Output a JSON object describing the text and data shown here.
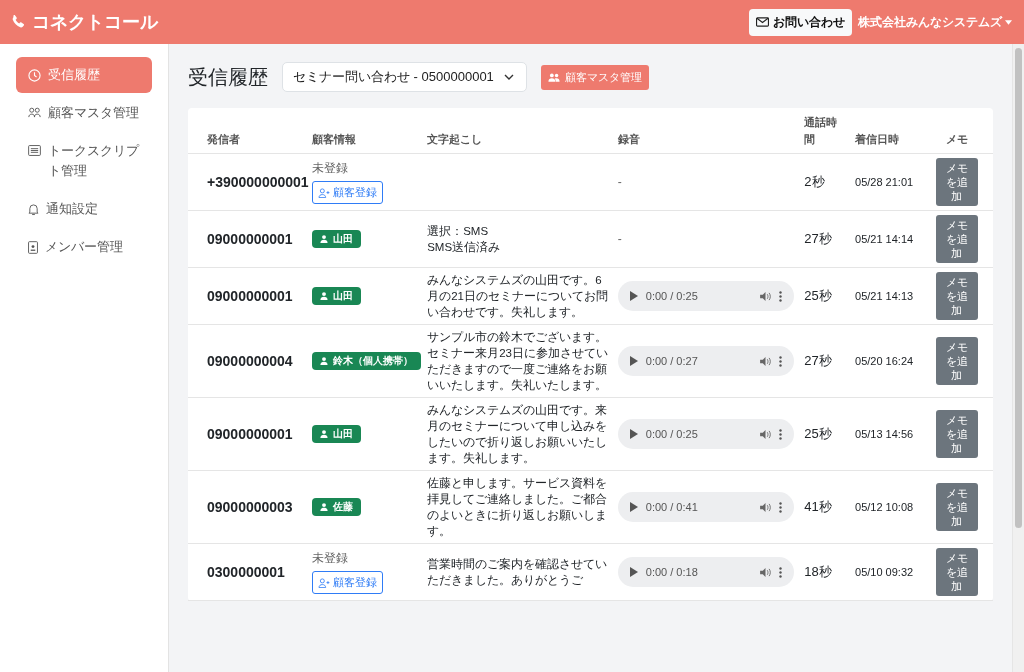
{
  "header": {
    "app_name": "コネクトコール",
    "contact_button": "お問い合わせ",
    "company_menu": "株式会社みんなシステムズ"
  },
  "sidebar": {
    "items": [
      {
        "label": "受信履歴",
        "selected": true
      },
      {
        "label": "顧客マスタ管理",
        "selected": false
      },
      {
        "label": "トークスクリプト管理",
        "selected": false
      },
      {
        "label": "通知設定",
        "selected": false
      },
      {
        "label": "メンバー管理",
        "selected": false
      }
    ]
  },
  "page": {
    "title": "受信履歴",
    "line_select": "セミナー問い合わせ - 0500000001",
    "customer_master_button": "顧客マスタ管理"
  },
  "table": {
    "columns": [
      "発信者",
      "顧客情報",
      "文字起こし",
      "録音",
      "通話時間",
      "着信日時",
      "メモ"
    ],
    "rows": [
      {
        "caller": "+390000000001",
        "customer": {
          "kind": "unregistered",
          "status": "未登録",
          "action": "顧客登録"
        },
        "transcript": "",
        "recording": "-",
        "duration": "2秒",
        "received": "05/28 21:01",
        "memo": "メモを追加"
      },
      {
        "caller": "09000000001",
        "customer": {
          "kind": "registered",
          "name": "山田"
        },
        "transcript": "選択：SMS\nSMS送信済み",
        "recording": "-",
        "duration": "27秒",
        "received": "05/21 14:14",
        "memo": "メモを追加"
      },
      {
        "caller": "09000000001",
        "customer": {
          "kind": "registered",
          "name": "山田"
        },
        "transcript": "みんなシステムズの山田です。6月の21日のセミナーについてお問い合わせです。失礼します。",
        "recording": "0:00 / 0:25",
        "duration": "25秒",
        "received": "05/21 14:13",
        "memo": "メモを追加"
      },
      {
        "caller": "09000000004",
        "customer": {
          "kind": "registered",
          "name": "鈴木（個人携帯）"
        },
        "transcript": "サンプル市の鈴木でございます。セミナー来月23日に参加させていただきますので一度ご連絡をお願いいたします。失礼いたします。",
        "recording": "0:00 / 0:27",
        "duration": "27秒",
        "received": "05/20 16:24",
        "memo": "メモを追加"
      },
      {
        "caller": "09000000001",
        "customer": {
          "kind": "registered",
          "name": "山田"
        },
        "transcript": "みんなシステムズの山田です。来月のセミナーについて申し込みをしたいので折り返しお願いいたします。失礼します。",
        "recording": "0:00 / 0:25",
        "duration": "25秒",
        "received": "05/13 14:56",
        "memo": "メモを追加"
      },
      {
        "caller": "09000000003",
        "customer": {
          "kind": "registered",
          "name": "佐藤"
        },
        "transcript": "佐藤と申します。サービス資料を拝見してご連絡しました。ご都合のよいときに折り返しお願いします。",
        "recording": "0:00 / 0:41",
        "duration": "41秒",
        "received": "05/12 10:08",
        "memo": "メモを追加"
      },
      {
        "caller": "0300000001",
        "customer": {
          "kind": "unregistered",
          "status": "未登録",
          "action": "顧客登録"
        },
        "transcript": "営業時間のご案内を確認させていただきました。ありがとうご",
        "recording": "0:00 / 0:18",
        "duration": "18秒",
        "received": "05/10 09:32",
        "memo": "メモを追加"
      }
    ]
  }
}
